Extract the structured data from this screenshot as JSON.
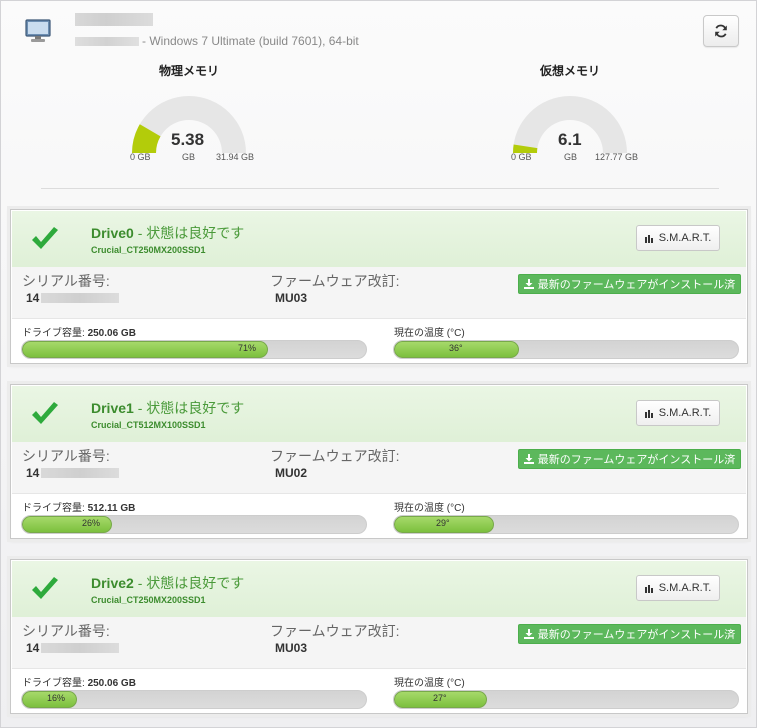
{
  "header": {
    "os_text": "- Windows 7 Ultimate (build 7601), 64-bit",
    "refresh_icon": "refresh-icon",
    "computer_icon": "computer-icon"
  },
  "memory": {
    "physical": {
      "title": "物理メモリ",
      "value": "5.38",
      "unit": "GB",
      "min": "0 GB",
      "max": "31.94 GB",
      "used": 5.38,
      "total": 31.94
    },
    "virtual": {
      "title": "仮想メモリ",
      "value": "6.1",
      "unit": "GB",
      "min": "0 GB",
      "max": "127.77 GB",
      "used": 6.1,
      "total": 127.77
    }
  },
  "labels": {
    "serial": "シリアル番号:",
    "firmware": "ファームウェア改訂:",
    "firmware_button": "最新のファームウェアがインストール済",
    "capacity_label": "ドライブ容量:",
    "temp_label": "現在の温度 (°C)",
    "smart_button": "S.M.A.R.T.",
    "status": "- 状態は良好です"
  },
  "colors": {
    "ok_green": "#3c8c2e",
    "header_bg": "#dff0d7",
    "bar_fill": "#8cc84b",
    "button_green": "#5cb85c"
  },
  "drives": [
    {
      "name": "Drive0",
      "model": "Crucial_CT250MX200SSD1",
      "serial_prefix": "14",
      "firmware": "MU03",
      "capacity": "250.06 GB",
      "usage_pct": 71,
      "usage_label": "71%",
      "temp": 36,
      "temp_label": "36°"
    },
    {
      "name": "Drive1",
      "model": "Crucial_CT512MX100SSD1",
      "serial_prefix": "14",
      "firmware": "MU02",
      "capacity": "512.11 GB",
      "usage_pct": 26,
      "usage_label": "26%",
      "temp": 29,
      "temp_label": "29°"
    },
    {
      "name": "Drive2",
      "model": "Crucial_CT250MX200SSD1",
      "serial_prefix": "14",
      "firmware": "MU03",
      "capacity": "250.06 GB",
      "usage_pct": 16,
      "usage_label": "16%",
      "temp": 27,
      "temp_label": "27°"
    }
  ]
}
